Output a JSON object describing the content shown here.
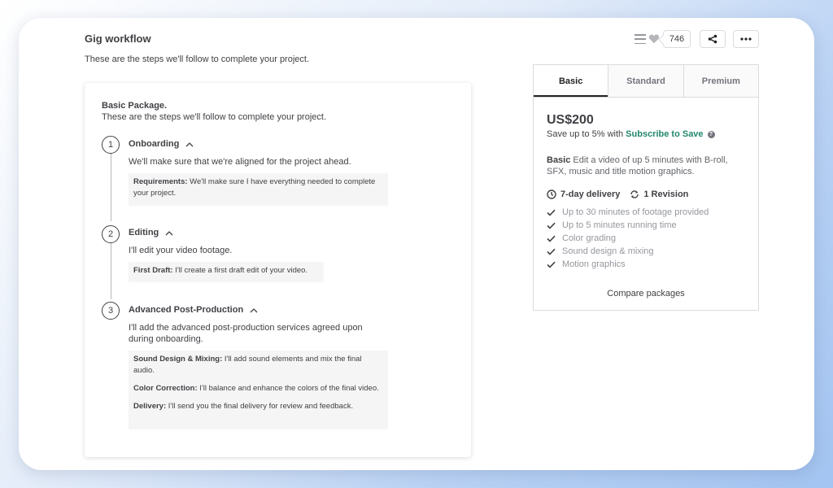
{
  "header": {
    "title": "Gig workflow",
    "subtitle": "These are the steps we'll follow to complete your project.",
    "like_count": "746"
  },
  "workflow": {
    "package_title": "Basic Package.",
    "package_desc": "These are the steps we'll follow to complete your project.",
    "steps": [
      {
        "num": "1",
        "title": "Onboarding",
        "desc": "We'll make sure that we're aligned for the project ahead.",
        "details": [
          {
            "label": "Requirements:",
            "text": " We'll make sure I have everything needed to complete your project."
          }
        ]
      },
      {
        "num": "2",
        "title": "Editing",
        "desc": "I'll edit your video footage.",
        "details": [
          {
            "label": "First Draft:",
            "text": " I'll create a first draft edit of your video."
          }
        ]
      },
      {
        "num": "3",
        "title": "Advanced Post-Production",
        "desc": "I'll add the advanced post-production services agreed upon during onboarding.",
        "details": [
          {
            "label": "Sound Design & Mixing:",
            "text": " I'll add sound elements and mix the final audio."
          },
          {
            "label": "Color Correction:",
            "text": " I'll balance and enhance the colors of the final video."
          },
          {
            "label": "Delivery:",
            "text": " I'll send you the final delivery for review and feedback."
          }
        ]
      }
    ]
  },
  "pricing": {
    "tabs": [
      "Basic",
      "Standard",
      "Premium"
    ],
    "active_tab": "Basic",
    "price": "US$200",
    "save_prefix": "Save up to 5% with",
    "save_link": "Subscribe to Save",
    "summary_label": "Basic",
    "summary_text": " Edit a video of up 5 minutes with B-roll, SFX, music and title motion graphics.",
    "delivery": "7-day delivery",
    "revisions": "1 Revision",
    "features": [
      "Up to 30 minutes of footage provided",
      "Up to 5 minutes running time",
      "Color grading",
      "Sound design & mixing",
      "Motion graphics"
    ],
    "compare_label": "Compare packages"
  },
  "icons": {
    "menu": "list-icon",
    "like": "heart-icon",
    "share": "share-icon",
    "more": "more-dots-icon",
    "clock": "clock-icon",
    "revision": "refresh-icon",
    "check": "check-icon",
    "help": "question-icon",
    "collapse": "chevron-up-icon"
  },
  "colors": {
    "accent_link": "#22876c",
    "text": "#404145",
    "muted": "#95979d"
  }
}
